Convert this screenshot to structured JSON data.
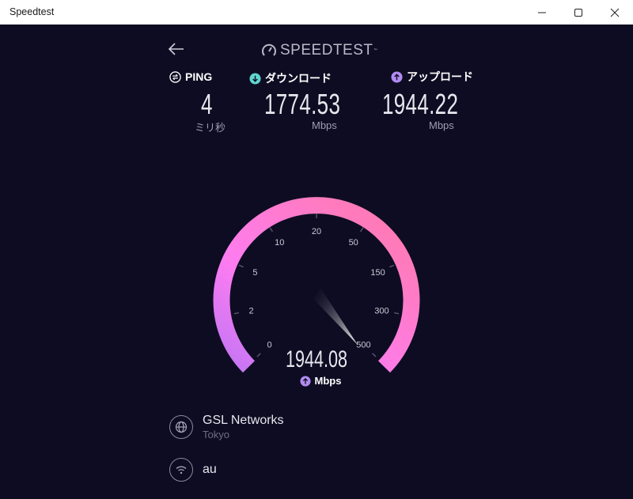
{
  "window": {
    "title": "Speedtest"
  },
  "logo": {
    "text": "SPEEDTEST"
  },
  "ping": {
    "label": "PING",
    "value": "4",
    "unit": "ミリ秒"
  },
  "download": {
    "label": "ダウンロード",
    "value": "1774.53",
    "unit": "Mbps"
  },
  "upload": {
    "label": "アップロード",
    "value": "1944.22",
    "unit": "Mbps"
  },
  "gauge": {
    "ticks": [
      "0",
      "2",
      "5",
      "10",
      "20",
      "50",
      "150",
      "300",
      "500"
    ],
    "reading": "1944.08",
    "unit": "Mbps"
  },
  "server": {
    "name": "GSL Networks",
    "location": "Tokyo"
  },
  "connection": {
    "name": "au"
  },
  "colors": {
    "background": "#0e0c22",
    "ping": "#ffffff",
    "download": "#5fd6cf",
    "upload": "#b08cf0",
    "gauge_start": "#c175f5",
    "gauge_end": "#ff7aa7"
  }
}
